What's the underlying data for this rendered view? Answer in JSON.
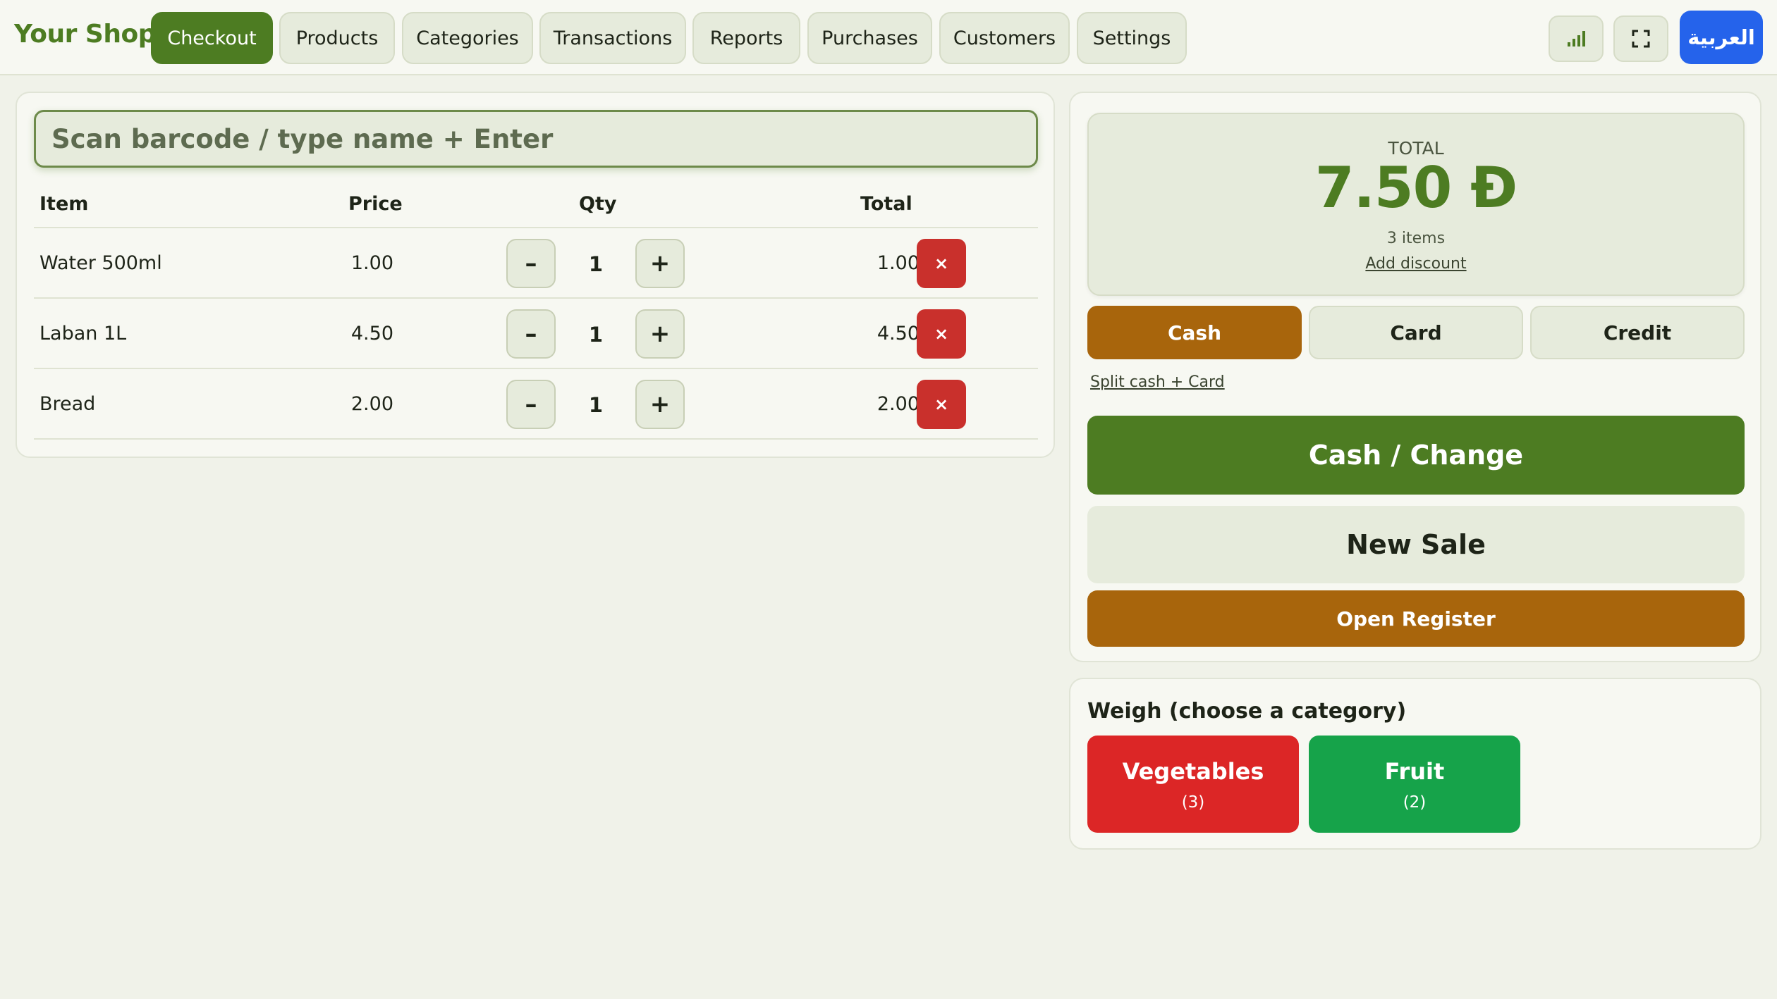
{
  "brand": "Your Shop",
  "nav": {
    "tabs": [
      {
        "label": "Checkout",
        "active": true
      },
      {
        "label": "Products",
        "active": false
      },
      {
        "label": "Categories",
        "active": false
      },
      {
        "label": "Transactions",
        "active": false
      },
      {
        "label": "Reports",
        "active": false
      },
      {
        "label": "Purchases",
        "active": false
      },
      {
        "label": "Customers",
        "active": false
      },
      {
        "label": "Settings",
        "active": false
      }
    ],
    "icons": [
      "bar-chart-icon",
      "fullscreen-icon"
    ],
    "language_button": "العربية"
  },
  "scan": {
    "placeholder": "Scan barcode / type name + Enter",
    "value": ""
  },
  "cart": {
    "headers": {
      "item": "Item",
      "price": "Price",
      "qty": "Qty",
      "total": "Total"
    },
    "rows": [
      {
        "item": "Water 500ml",
        "price": "1.00",
        "qty": "1",
        "total": "1.00"
      },
      {
        "item": "Laban 1L",
        "price": "4.50",
        "qty": "1",
        "total": "4.50"
      },
      {
        "item": "Bread",
        "price": "2.00",
        "qty": "1",
        "total": "2.00"
      }
    ],
    "minus_symbol": "–",
    "plus_symbol": "+",
    "remove_symbol": "×"
  },
  "summary": {
    "total_label": "TOTAL",
    "total_amount": "7.50 Đ",
    "items_count": "3 items",
    "discount_link": "Add discount"
  },
  "payment": {
    "methods": [
      {
        "label": "Cash",
        "active": true
      },
      {
        "label": "Card",
        "active": false
      },
      {
        "label": "Credit",
        "active": false
      }
    ],
    "split_link": "Split cash + Card",
    "cash_change": "Cash / Change",
    "new_sale": "New Sale",
    "open_register": "Open Register"
  },
  "weigh": {
    "title": "Weigh (choose a category)",
    "categories": [
      {
        "name": "Vegetables",
        "count": "(3)",
        "color": "#dc2626"
      },
      {
        "name": "Fruit",
        "count": "(2)",
        "color": "#16a34a"
      }
    ]
  },
  "colors": {
    "primary": "#4d7c22",
    "accent": "#a8650c",
    "danger": "#c9302c",
    "language": "#2563eb"
  }
}
